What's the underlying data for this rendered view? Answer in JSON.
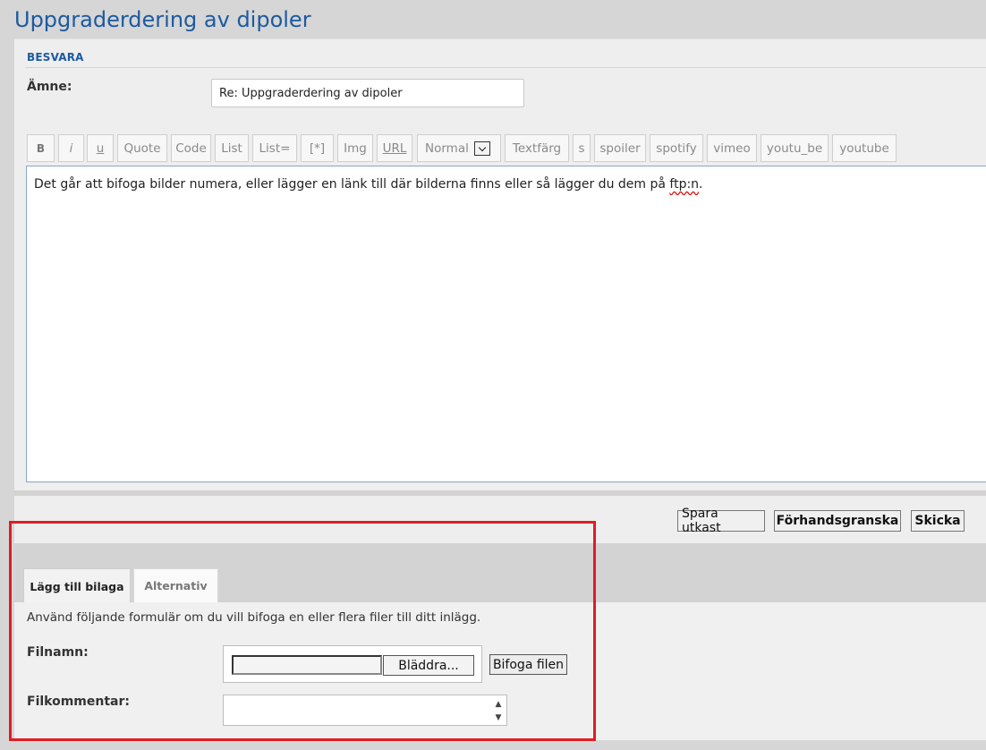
{
  "page": {
    "title": "Uppgraderdering av dipoler"
  },
  "reply": {
    "section_label": "BESVARA",
    "subject_label": "Ämne:",
    "subject_value": "Re: Uppgraderdering av dipoler"
  },
  "toolbar": {
    "bold": "B",
    "italic": "i",
    "underline": "u",
    "quote": "Quote",
    "code": "Code",
    "list": "List",
    "list_eq": "List=",
    "list_item": "[*]",
    "img": "Img",
    "url": "URL",
    "font_size": "Normal",
    "color": "Textfärg",
    "strike": "s",
    "spoiler": "spoiler",
    "spotify": "spotify",
    "vimeo": "vimeo",
    "youtu_be": "youtu_be",
    "youtube": "youtube"
  },
  "editor": {
    "text_before": "Det går att bifoga bilder numera, eller lägger en länk till där bilderna finns eller så lägger du dem på ",
    "misspelled": "ftp:n",
    "text_after": "."
  },
  "actions": {
    "save_draft": "Spara utkast",
    "preview": "Förhandsgranska",
    "submit": "Skicka"
  },
  "tabs": [
    {
      "label": "Lägg till bilaga",
      "active": true
    },
    {
      "label": "Alternativ",
      "active": false
    }
  ],
  "attachment": {
    "description": "Använd följande formulär om du vill bifoga en eller flera filer till ditt inlägg.",
    "filename_label": "Filnamn:",
    "browse_label": "Bläddra...",
    "attach_label": "Bifoga filen",
    "comment_label": "Filkommentar:"
  },
  "colors": {
    "title": "#1d5aa0",
    "highlight": "#e01c24"
  }
}
